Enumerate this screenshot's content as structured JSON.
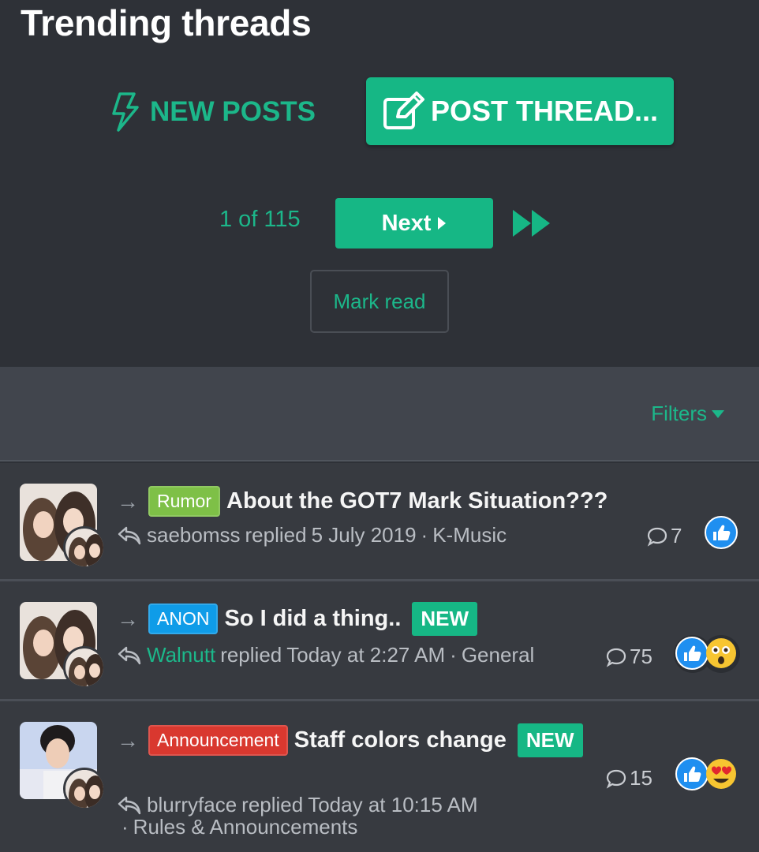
{
  "header": {
    "title": "Trending threads",
    "new_posts_label": "NEW POSTS",
    "post_thread_label": "POST THREAD..."
  },
  "pagination": {
    "page_info": "1 of 115",
    "next_label": "Next"
  },
  "mark_read_label": "Mark read",
  "filters_label": "Filters",
  "colors": {
    "accent": "#16b785",
    "background": "#2e3137",
    "row": "#373a40",
    "prefix_rumor": "#7ec047",
    "prefix_anon": "#0f9ce8",
    "prefix_announcement": "#d9382f"
  },
  "threads": [
    {
      "prefix": "Rumor",
      "title": "About the GOT7 Mark Situation???",
      "user": "saebomss",
      "action": "replied",
      "date": "5 July 2019",
      "forum": "K-Music",
      "replies": "7",
      "reactions": [
        "like-icon"
      ]
    },
    {
      "prefix": "ANON",
      "title": "So I did a thing..",
      "badge": "NEW",
      "user": "Walnutt",
      "action": "replied",
      "date": "Today at 2:27 AM",
      "forum": "General",
      "replies": "75",
      "reactions": [
        "like-icon",
        "wow-icon"
      ]
    },
    {
      "prefix": "Announcement",
      "title": "Staff colors change",
      "badge": "NEW",
      "user": "blurryface",
      "action": "replied",
      "date": "Today at 10:15 AM",
      "forum": "Rules & Announcements",
      "replies": "15",
      "reactions": [
        "like-icon",
        "love-icon"
      ]
    }
  ]
}
